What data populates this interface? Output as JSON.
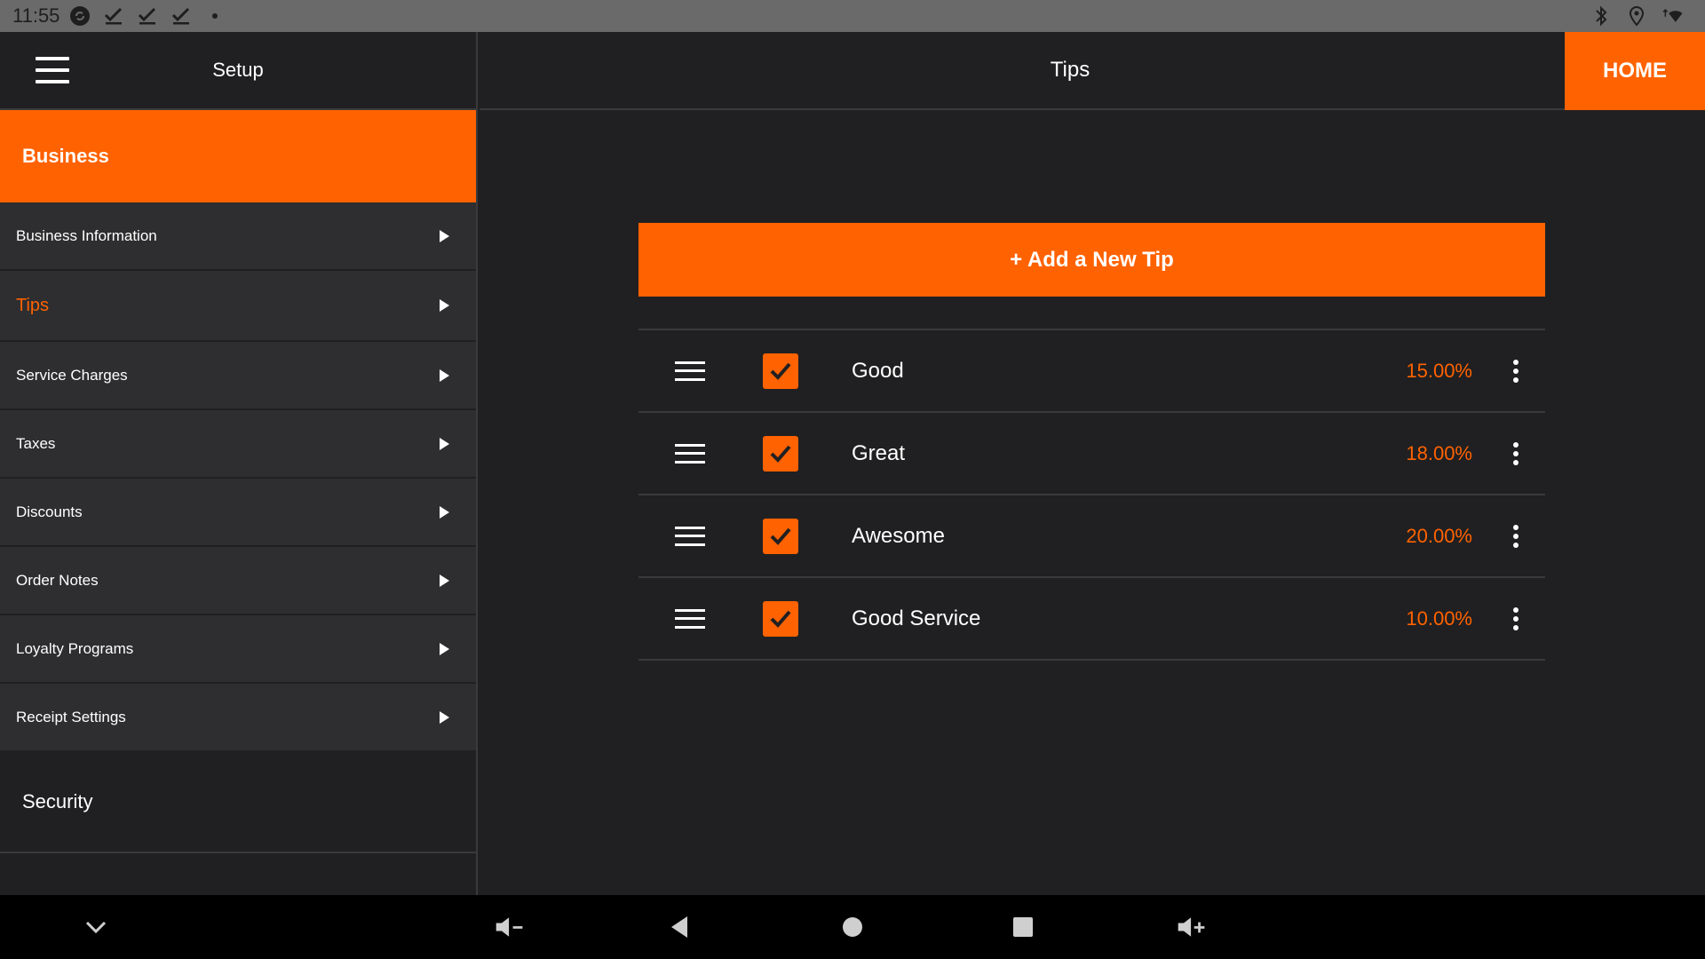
{
  "status_bar": {
    "time": "11:55",
    "left_icons": [
      "sync-icon",
      "check-icon",
      "check-icon",
      "check-icon",
      "dot-icon"
    ],
    "right_icons": [
      "bluetooth-icon",
      "location-icon",
      "wifi-icon"
    ]
  },
  "sidebar": {
    "title": "Setup",
    "section_business": "Business",
    "items": [
      {
        "label": "Business Information",
        "active": false
      },
      {
        "label": "Tips",
        "active": true
      },
      {
        "label": "Service Charges",
        "active": false
      },
      {
        "label": "Taxes",
        "active": false
      },
      {
        "label": "Discounts",
        "active": false
      },
      {
        "label": "Order Notes",
        "active": false
      },
      {
        "label": "Loyalty Programs",
        "active": false
      },
      {
        "label": "Receipt Settings",
        "active": false
      }
    ],
    "section_security": "Security"
  },
  "main": {
    "title": "Tips",
    "home_label": "HOME",
    "add_tip_label": "+ Add a New Tip",
    "tips": [
      {
        "name": "Good",
        "percent": "15.00%",
        "checked": true
      },
      {
        "name": "Great",
        "percent": "18.00%",
        "checked": true
      },
      {
        "name": "Awesome",
        "percent": "20.00%",
        "checked": true
      },
      {
        "name": "Good Service",
        "percent": "10.00%",
        "checked": true
      }
    ]
  },
  "colors": {
    "accent": "#ff6200",
    "background": "#202022",
    "panel": "#2e2e30",
    "status_bar": "#6a6a6a"
  },
  "nav_bar": {
    "buttons": [
      "chevron-down-icon",
      "volume-down-icon",
      "back-icon",
      "home-icon",
      "recents-icon",
      "volume-up-icon"
    ]
  }
}
